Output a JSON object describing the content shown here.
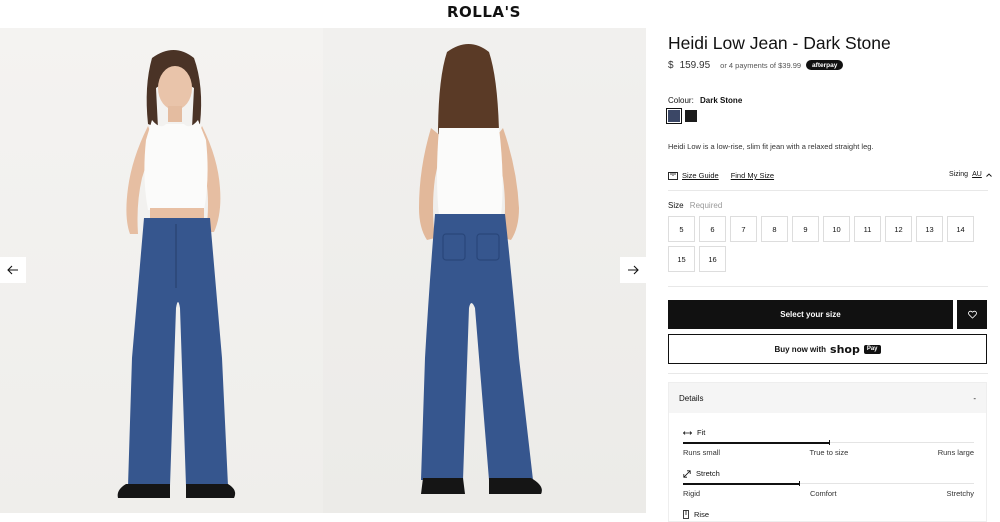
{
  "header": {
    "logo": "ROLLA'S"
  },
  "gallery": {
    "prev": "Previous image",
    "next": "Next image"
  },
  "product": {
    "title": "Heidi Low Jean - Dark Stone",
    "currency": "$",
    "price": "159.95",
    "installments": "or 4 payments of $39.99",
    "afterpay": "afterpay",
    "colour_label": "Colour:",
    "colour_value": "Dark Stone",
    "description": "Heidi Low is a low-rise, slim fit jean with a relaxed straight leg.",
    "swatch_colors": [
      "#3b4766",
      "#1c1c1c"
    ]
  },
  "size_tools": {
    "size_guide": "Size Guide",
    "find_size": "Find My Size",
    "sizing_label": "Sizing",
    "sizing_value": "AU"
  },
  "sizes": {
    "label": "Size",
    "required": "Required",
    "options": [
      "5",
      "6",
      "7",
      "8",
      "9",
      "10",
      "11",
      "12",
      "13",
      "14",
      "15",
      "16"
    ]
  },
  "actions": {
    "select_size": "Select your size",
    "buy_now": "Buy now with",
    "shop": "shop",
    "pay": "Pay"
  },
  "details": {
    "title": "Details",
    "toggle": "-",
    "fit": {
      "label": "Fit",
      "left": "Runs small",
      "middle": "True to size",
      "right": "Runs large",
      "level": 0.5
    },
    "stretch": {
      "label": "Stretch",
      "left": "Rigid",
      "middle": "Comfort",
      "right": "Stretchy",
      "level": 0.4
    },
    "rise": {
      "label": "Rise"
    }
  }
}
